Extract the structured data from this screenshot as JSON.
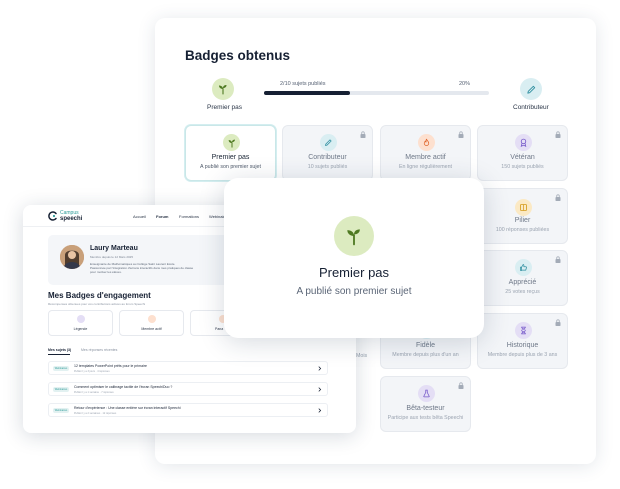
{
  "panel": {
    "title": "Badges obtenus",
    "progress": {
      "left_label": "Premier pas",
      "right_label": "Contributeur",
      "count_text": "2/10 sujets publiés",
      "percent_text": "20%",
      "fraction": 0.38
    },
    "badges": [
      {
        "title": "Premier pas",
        "desc": "A publié son premier sujet",
        "icon": "sprout-icon",
        "color": "#dcebc0",
        "active": true
      },
      {
        "title": "Contributeur",
        "desc": "10 sujets publiés",
        "icon": "pencil-icon",
        "color": "#d9eef2",
        "active": false
      },
      {
        "title": "Membre actif",
        "desc": "En ligne régulièrement",
        "icon": "flame-icon",
        "color": "#fde0cf",
        "active": false
      },
      {
        "title": "Vétéran",
        "desc": "150 sujets publiés",
        "icon": "medal-icon",
        "color": "#e4def5",
        "active": false
      },
      {
        "title": "Pilier",
        "desc": "100 réponses publiées",
        "icon": "book-icon",
        "color": "#fbe9c4",
        "active": false
      },
      {
        "title": "Apprécié",
        "desc": "25 votes reçus",
        "icon": "thumbs-up-icon",
        "color": "#d9eef2",
        "active": false
      },
      {
        "title": "Fidèle",
        "desc": "Membre depuis plus d'un an",
        "icon": "heart-icon",
        "color": "#d9eef2",
        "active": false
      },
      {
        "title": "Historique",
        "desc": "Membre depuis plus de 3 ans",
        "icon": "hourglass-icon",
        "color": "#e4def5",
        "active": false
      },
      {
        "title": "Bêta-testeur",
        "desc": "Participe aux tests bêta Speechi",
        "icon": "flask-icon",
        "color": "#e4def5",
        "active": false
      }
    ],
    "partial_desc": "Mois"
  },
  "popup": {
    "title": "Premier pas",
    "desc": "A publié son premier sujet"
  },
  "profile_window": {
    "logo_top": "Campus",
    "logo_bottom": "speechi",
    "nav": [
      "Accueil",
      "Forum",
      "Formations",
      "Webinaires"
    ],
    "user": {
      "name": "Laury Marteau",
      "meta": "Membre depuis le 12 Mars 2025",
      "bio_lines": [
        "Enseignante de Mathématiques au Collège Saint Laurent Ecole.",
        "Passionnée par l'intégration d'écrans interactifs dans mes pratiques de classe",
        "pour motiver les élèves."
      ]
    },
    "section_title": "Mes Badges d'engagement",
    "section_sub": "Récompenses obtenues pour vos contributions actives au forum Speechi",
    "mini_badges": [
      {
        "label": "Légende",
        "color": "#e4def5"
      },
      {
        "label": "Membre actif",
        "color": "#fde0cf"
      },
      {
        "label": "Pana",
        "color": "#fde0cf"
      }
    ],
    "tabs": [
      "Mes sujets (3)",
      "Mes réponses récentes"
    ],
    "topic_badge": "Webinaires",
    "topics": [
      {
        "title": "12 templates PowerPoint prêts pour le primaire",
        "meta": "Publié il y a 3 jours · 4 réponses"
      },
      {
        "title": "Comment optimiser le calibrage tactile de l'écran SpeechiDuo ?",
        "meta": "Publié il y a 1 semaine · 7 réponses"
      },
      {
        "title": "Retour d'expérience : Une classe entière sur écran interactif Speechi",
        "meta": "Publié il y a 2 semaines · 12 réponses"
      }
    ]
  }
}
